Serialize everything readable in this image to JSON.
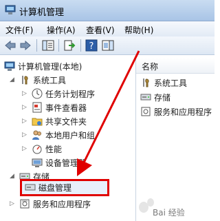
{
  "window": {
    "title": "计算机管理"
  },
  "menu": [
    "文件(F)",
    "操作(A)",
    "查看(V)",
    "帮助(H)"
  ],
  "toolbar": {
    "help_glyph": "?"
  },
  "tree": {
    "root": "计算机管理(本地)",
    "system_tools": "系统工具",
    "task_scheduler": "任务计划程序",
    "event_viewer": "事件查看器",
    "shared_folders": "共享文件夹",
    "local_users": "本地用户和组",
    "performance": "性能",
    "device_manager": "设备管理器",
    "storage": "存储",
    "disk_management": "磁盘管理",
    "services_apps": "服务和应用程序"
  },
  "right": {
    "header": "名称",
    "items": [
      "系统工具",
      "存储",
      "服务和应用程序"
    ]
  },
  "watermark": "Bai 经验",
  "colors": {
    "highlight": "#e00000",
    "selection": "#e8f0fb"
  }
}
